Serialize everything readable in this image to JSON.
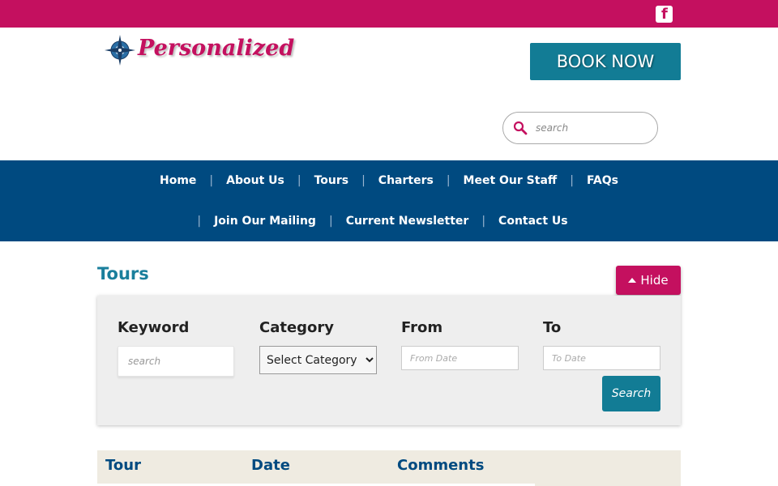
{
  "topbar": {
    "facebook_icon": "facebook-icon",
    "color": "#c4105f"
  },
  "header": {
    "logo_text": "Personalized",
    "book_now_label": "BOOK NOW",
    "search_placeholder": "search"
  },
  "nav": {
    "row1": [
      "Home",
      "About Us",
      "Tours",
      "Charters",
      "Meet Our Staff",
      "FAQs"
    ],
    "row2": [
      "Join Our Mailing",
      "Current Newsletter",
      "Contact Us"
    ]
  },
  "main": {
    "title": "Tours",
    "hide_label": "Hide"
  },
  "filters": {
    "keyword_label": "Keyword",
    "keyword_placeholder": "search",
    "category_label": "Category",
    "category_selected": "Select Category",
    "from_label": "From",
    "from_placeholder": "From Date",
    "to_label": "To",
    "to_placeholder": "To Date",
    "search_button": "Search"
  },
  "table": {
    "columns": [
      "Tour",
      "Date",
      "Comments"
    ]
  },
  "colors": {
    "brand_pink": "#c4105f",
    "nav_blue": "#004a80",
    "teal": "#127c95"
  }
}
